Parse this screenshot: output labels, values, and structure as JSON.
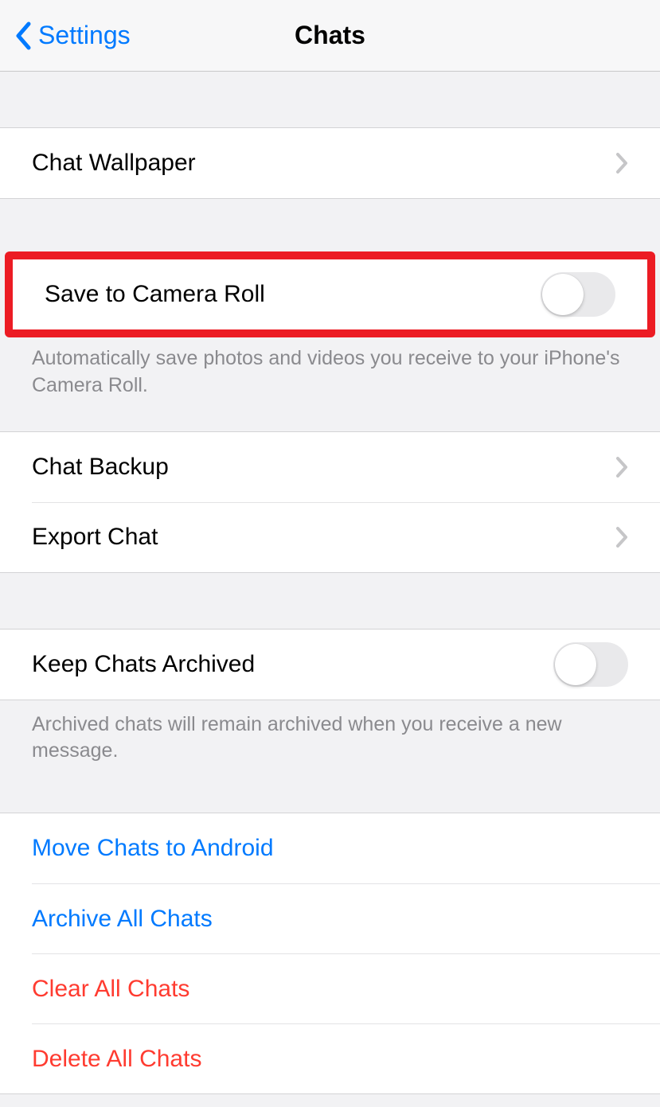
{
  "header": {
    "back_label": "Settings",
    "title": "Chats"
  },
  "wallpaper": {
    "label": "Chat Wallpaper"
  },
  "save_to_camera_roll": {
    "label": "Save to Camera Roll",
    "footer": "Automatically save photos and videos you receive to your iPhone's Camera Roll.",
    "enabled": false
  },
  "backup": {
    "chat_backup_label": "Chat Backup",
    "export_chat_label": "Export Chat"
  },
  "keep_archived": {
    "label": "Keep Chats Archived",
    "footer": "Archived chats will remain archived when you receive a new message.",
    "enabled": false
  },
  "actions": {
    "move_to_android": "Move Chats to Android",
    "archive_all": "Archive All Chats",
    "clear_all": "Clear All Chats",
    "delete_all": "Delete All Chats"
  }
}
